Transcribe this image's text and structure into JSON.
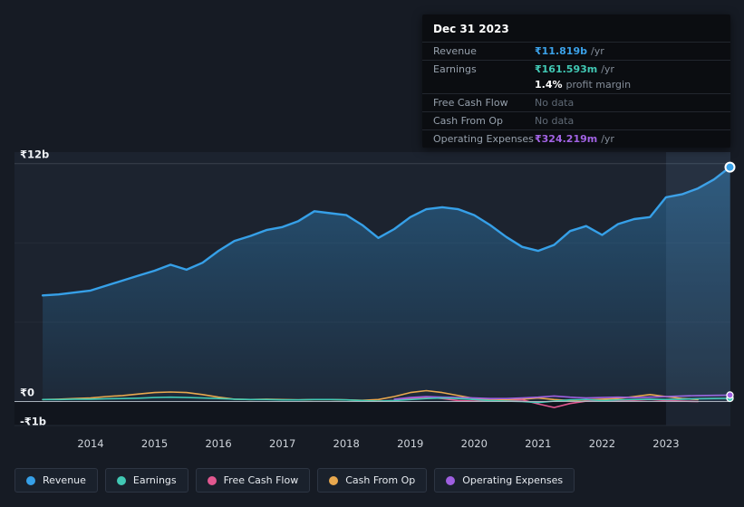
{
  "tooltip": {
    "date": "Dec 31 2023",
    "rows": [
      {
        "label": "Revenue",
        "value": "₹11.819b",
        "suffix": "/yr",
        "color": "#3ba1e8",
        "divider": true
      },
      {
        "label": "Earnings",
        "value": "₹161.593m",
        "suffix": "/yr",
        "color": "#41c8b4",
        "divider": true
      },
      {
        "label": "",
        "value": "1.4%",
        "suffix": "profit margin",
        "color": "#ffffff",
        "divider": false
      },
      {
        "label": "Free Cash Flow",
        "value": "No data",
        "suffix": "",
        "color": "#5f6975",
        "divider": true
      },
      {
        "label": "Cash From Op",
        "value": "No data",
        "suffix": "",
        "color": "#5f6975",
        "divider": true
      },
      {
        "label": "Operating Expenses",
        "value": "₹324.219m",
        "suffix": "/yr",
        "color": "#a263e4",
        "divider": true
      }
    ]
  },
  "legend": {
    "items": [
      {
        "label": "Revenue",
        "color": "#36a0e8"
      },
      {
        "label": "Earnings",
        "color": "#41c8b4"
      },
      {
        "label": "Free Cash Flow",
        "color": "#e25890"
      },
      {
        "label": "Cash From Op",
        "color": "#e8a84e"
      },
      {
        "label": "Operating Expenses",
        "color": "#9e5fe0"
      }
    ]
  },
  "chart_data": {
    "type": "area",
    "title": "Revenue & Expenses history",
    "unit": "billions INR per year",
    "ylim": [
      -1.2,
      12.6
    ],
    "highlight_from": 2023,
    "y_ticks": [
      {
        "label": "₹12b",
        "value": 12
      },
      {
        "label": "₹0",
        "value": 0
      },
      {
        "label": "-₹1b",
        "value": -1
      }
    ],
    "x_ticks": [
      2014,
      2015,
      2016,
      2017,
      2018,
      2019,
      2020,
      2021,
      2022,
      2023
    ],
    "x": [
      2013.25,
      2013.5,
      2013.75,
      2014,
      2014.25,
      2014.5,
      2014.75,
      2015,
      2015.25,
      2015.5,
      2015.75,
      2016,
      2016.25,
      2016.5,
      2016.75,
      2017,
      2017.25,
      2017.5,
      2017.75,
      2018,
      2018.25,
      2018.5,
      2018.75,
      2019,
      2019.25,
      2019.5,
      2019.75,
      2020,
      2020.25,
      2020.5,
      2020.75,
      2021,
      2021.25,
      2021.5,
      2021.75,
      2022,
      2022.25,
      2022.5,
      2022.75,
      2023,
      2023.25,
      2023.5,
      2023.75,
      2024
    ],
    "series": [
      {
        "name": "Revenue",
        "color": "#36a0e8",
        "values": [
          5.35,
          5.4,
          5.5,
          5.6,
          5.85,
          6.1,
          6.35,
          6.6,
          6.9,
          6.65,
          7.0,
          7.6,
          8.1,
          8.35,
          8.65,
          8.8,
          9.1,
          9.6,
          9.5,
          9.4,
          8.9,
          8.25,
          8.7,
          9.3,
          9.7,
          9.8,
          9.7,
          9.4,
          8.9,
          8.3,
          7.8,
          7.6,
          7.9,
          8.6,
          8.85,
          8.4,
          8.95,
          9.2,
          9.3,
          10.3,
          10.45,
          10.75,
          11.2,
          11.82
        ]
      },
      {
        "name": "Earnings",
        "color": "#41c8b4",
        "values": [
          0.1,
          0.1,
          0.12,
          0.12,
          0.14,
          0.15,
          0.17,
          0.2,
          0.22,
          0.2,
          0.18,
          0.15,
          0.12,
          0.1,
          0.1,
          0.08,
          0.08,
          0.1,
          0.1,
          0.08,
          0.05,
          0.02,
          0.05,
          0.1,
          0.15,
          0.18,
          0.15,
          0.1,
          0.05,
          0.02,
          0.0,
          -0.05,
          0.02,
          0.08,
          0.1,
          0.05,
          0.08,
          0.1,
          0.12,
          0.1,
          0.12,
          0.14,
          0.15,
          0.162
        ]
      },
      {
        "name": "Free Cash Flow",
        "color": "#e25890",
        "values": [
          null,
          null,
          null,
          null,
          null,
          null,
          null,
          null,
          null,
          null,
          null,
          null,
          null,
          null,
          null,
          null,
          null,
          null,
          null,
          null,
          null,
          0.02,
          0.05,
          0.15,
          0.22,
          0.15,
          0.05,
          0.02,
          0.06,
          0.02,
          0.08,
          -0.12,
          -0.3,
          -0.1,
          0.02,
          0.06,
          0.02,
          0.06,
          0.1,
          0.05,
          0.02,
          0.0,
          null,
          null
        ]
      },
      {
        "name": "Cash From Op",
        "color": "#e8a84e",
        "values": [
          0.1,
          0.12,
          0.15,
          0.18,
          0.25,
          0.3,
          0.38,
          0.45,
          0.48,
          0.45,
          0.35,
          0.22,
          0.12,
          0.1,
          0.12,
          0.1,
          0.08,
          0.1,
          0.1,
          0.08,
          0.06,
          0.1,
          0.25,
          0.45,
          0.55,
          0.45,
          0.3,
          0.15,
          0.1,
          0.08,
          0.12,
          0.18,
          0.1,
          0.05,
          0.08,
          0.12,
          0.15,
          0.25,
          0.35,
          0.25,
          0.15,
          0.1,
          null,
          null
        ]
      },
      {
        "name": "Operating Expenses",
        "color": "#9e5fe0",
        "values": [
          null,
          null,
          null,
          null,
          null,
          null,
          null,
          null,
          null,
          null,
          null,
          null,
          null,
          null,
          null,
          null,
          null,
          null,
          null,
          null,
          null,
          null,
          0.12,
          0.2,
          0.25,
          0.22,
          0.2,
          0.18,
          0.15,
          0.15,
          0.18,
          0.22,
          0.28,
          0.22,
          0.18,
          0.2,
          0.22,
          0.2,
          0.22,
          0.25,
          0.28,
          0.3,
          0.31,
          0.324
        ]
      }
    ]
  }
}
